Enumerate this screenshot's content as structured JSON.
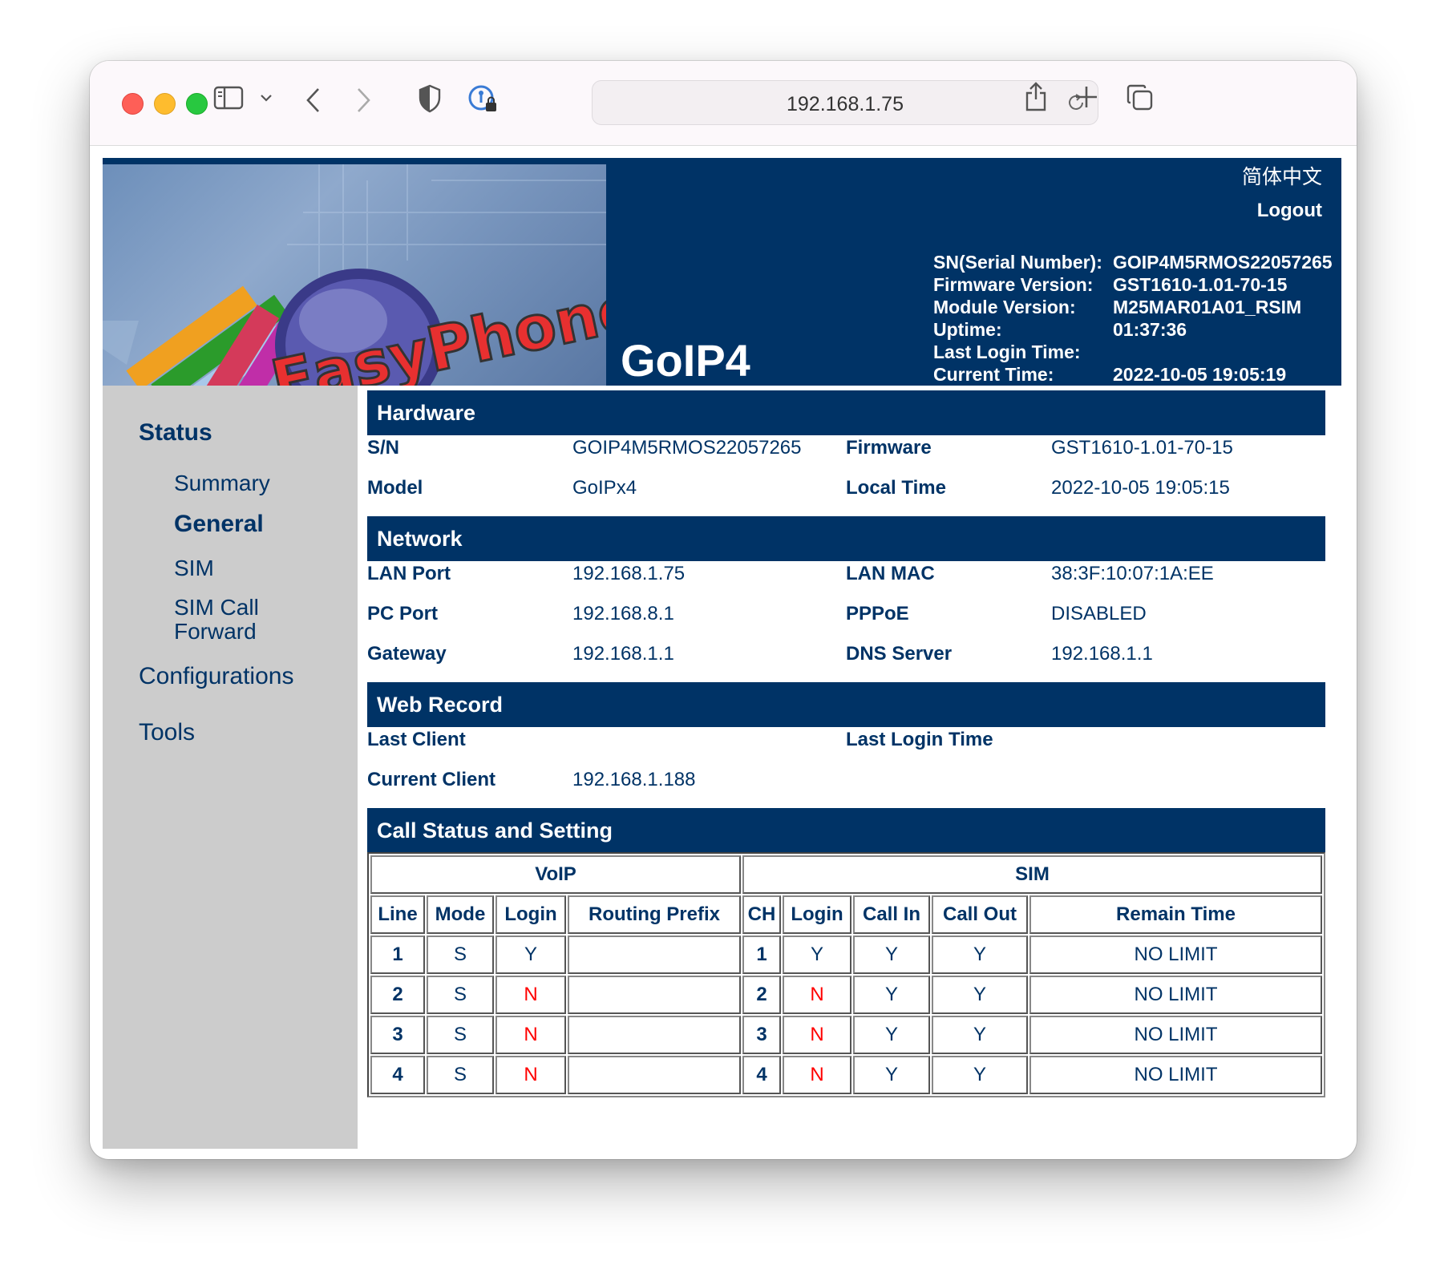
{
  "browser": {
    "url": "192.168.1.75",
    "icons": [
      "sidebar-icon",
      "chevron-down-icon",
      "back-icon",
      "forward-icon",
      "privacy-shield-icon",
      "password-key-icon",
      "reload-icon",
      "share-icon",
      "plus-icon",
      "tabs-icon"
    ]
  },
  "header": {
    "logo_text": "EasyPhone",
    "product": "GoIP4",
    "language": "简体中文",
    "logout": "Logout",
    "info": [
      {
        "label": "SN(Serial Number):",
        "value": "GOIP4M5RMOS22057265"
      },
      {
        "label": "Firmware Version:",
        "value": "GST1610-1.01-70-15"
      },
      {
        "label": "Module Version:",
        "value": "M25MAR01A01_RSIM"
      },
      {
        "label": "Uptime:",
        "value": "01:37:36"
      },
      {
        "label": "Last Login Time:",
        "value": ""
      },
      {
        "label": "Current Time:",
        "value": "2022-10-05 19:05:19"
      }
    ]
  },
  "sidebar": {
    "status": "Status",
    "summary": "Summary",
    "general": "General",
    "sim": "SIM",
    "sim_call_forward_1": "SIM Call",
    "sim_call_forward_2": "Forward",
    "configurations": "Configurations",
    "tools": "Tools"
  },
  "hardware": {
    "title": "Hardware",
    "sn_label": "S/N",
    "sn": "GOIP4M5RMOS22057265",
    "firmware_label": "Firmware",
    "firmware": "GST1610-1.01-70-15",
    "model_label": "Model",
    "model": "GoIPx4",
    "local_time_label": "Local Time",
    "local_time": "2022-10-05 19:05:15"
  },
  "network": {
    "title": "Network",
    "lan_port_label": "LAN Port",
    "lan_port": "192.168.1.75",
    "lan_mac_label": "LAN MAC",
    "lan_mac": "38:3F:10:07:1A:EE",
    "pc_port_label": "PC Port",
    "pc_port": "192.168.8.1",
    "pppoe_label": "PPPoE",
    "pppoe": "DISABLED",
    "gateway_label": "Gateway",
    "gateway": "192.168.1.1",
    "dns_label": "DNS Server",
    "dns": "192.168.1.1"
  },
  "web_record": {
    "title": "Web Record",
    "last_client_label": "Last Client",
    "last_client": "",
    "last_login_label": "Last Login Time",
    "last_login": "",
    "current_client_label": "Current Client",
    "current_client": "192.168.1.188"
  },
  "calls": {
    "title": "Call Status and Setting",
    "voip_group": "VoIP",
    "sim_group": "SIM",
    "headers": [
      "Line",
      "Mode",
      "Login",
      "Routing Prefix",
      "CH",
      "Login",
      "Call In",
      "Call Out",
      "Remain Time"
    ],
    "rows": [
      [
        "1",
        "S",
        "Y",
        "",
        "1",
        "Y",
        "Y",
        "Y",
        "NO LIMIT"
      ],
      [
        "2",
        "S",
        "N",
        "",
        "2",
        "N",
        "Y",
        "Y",
        "NO LIMIT"
      ],
      [
        "3",
        "S",
        "N",
        "",
        "3",
        "N",
        "Y",
        "Y",
        "NO LIMIT"
      ],
      [
        "4",
        "S",
        "N",
        "",
        "4",
        "N",
        "Y",
        "Y",
        "NO LIMIT"
      ]
    ]
  },
  "colors": {
    "navy": "#003366",
    "sidebar_gray": "#cccccc",
    "negative_red": "#ff0000"
  }
}
